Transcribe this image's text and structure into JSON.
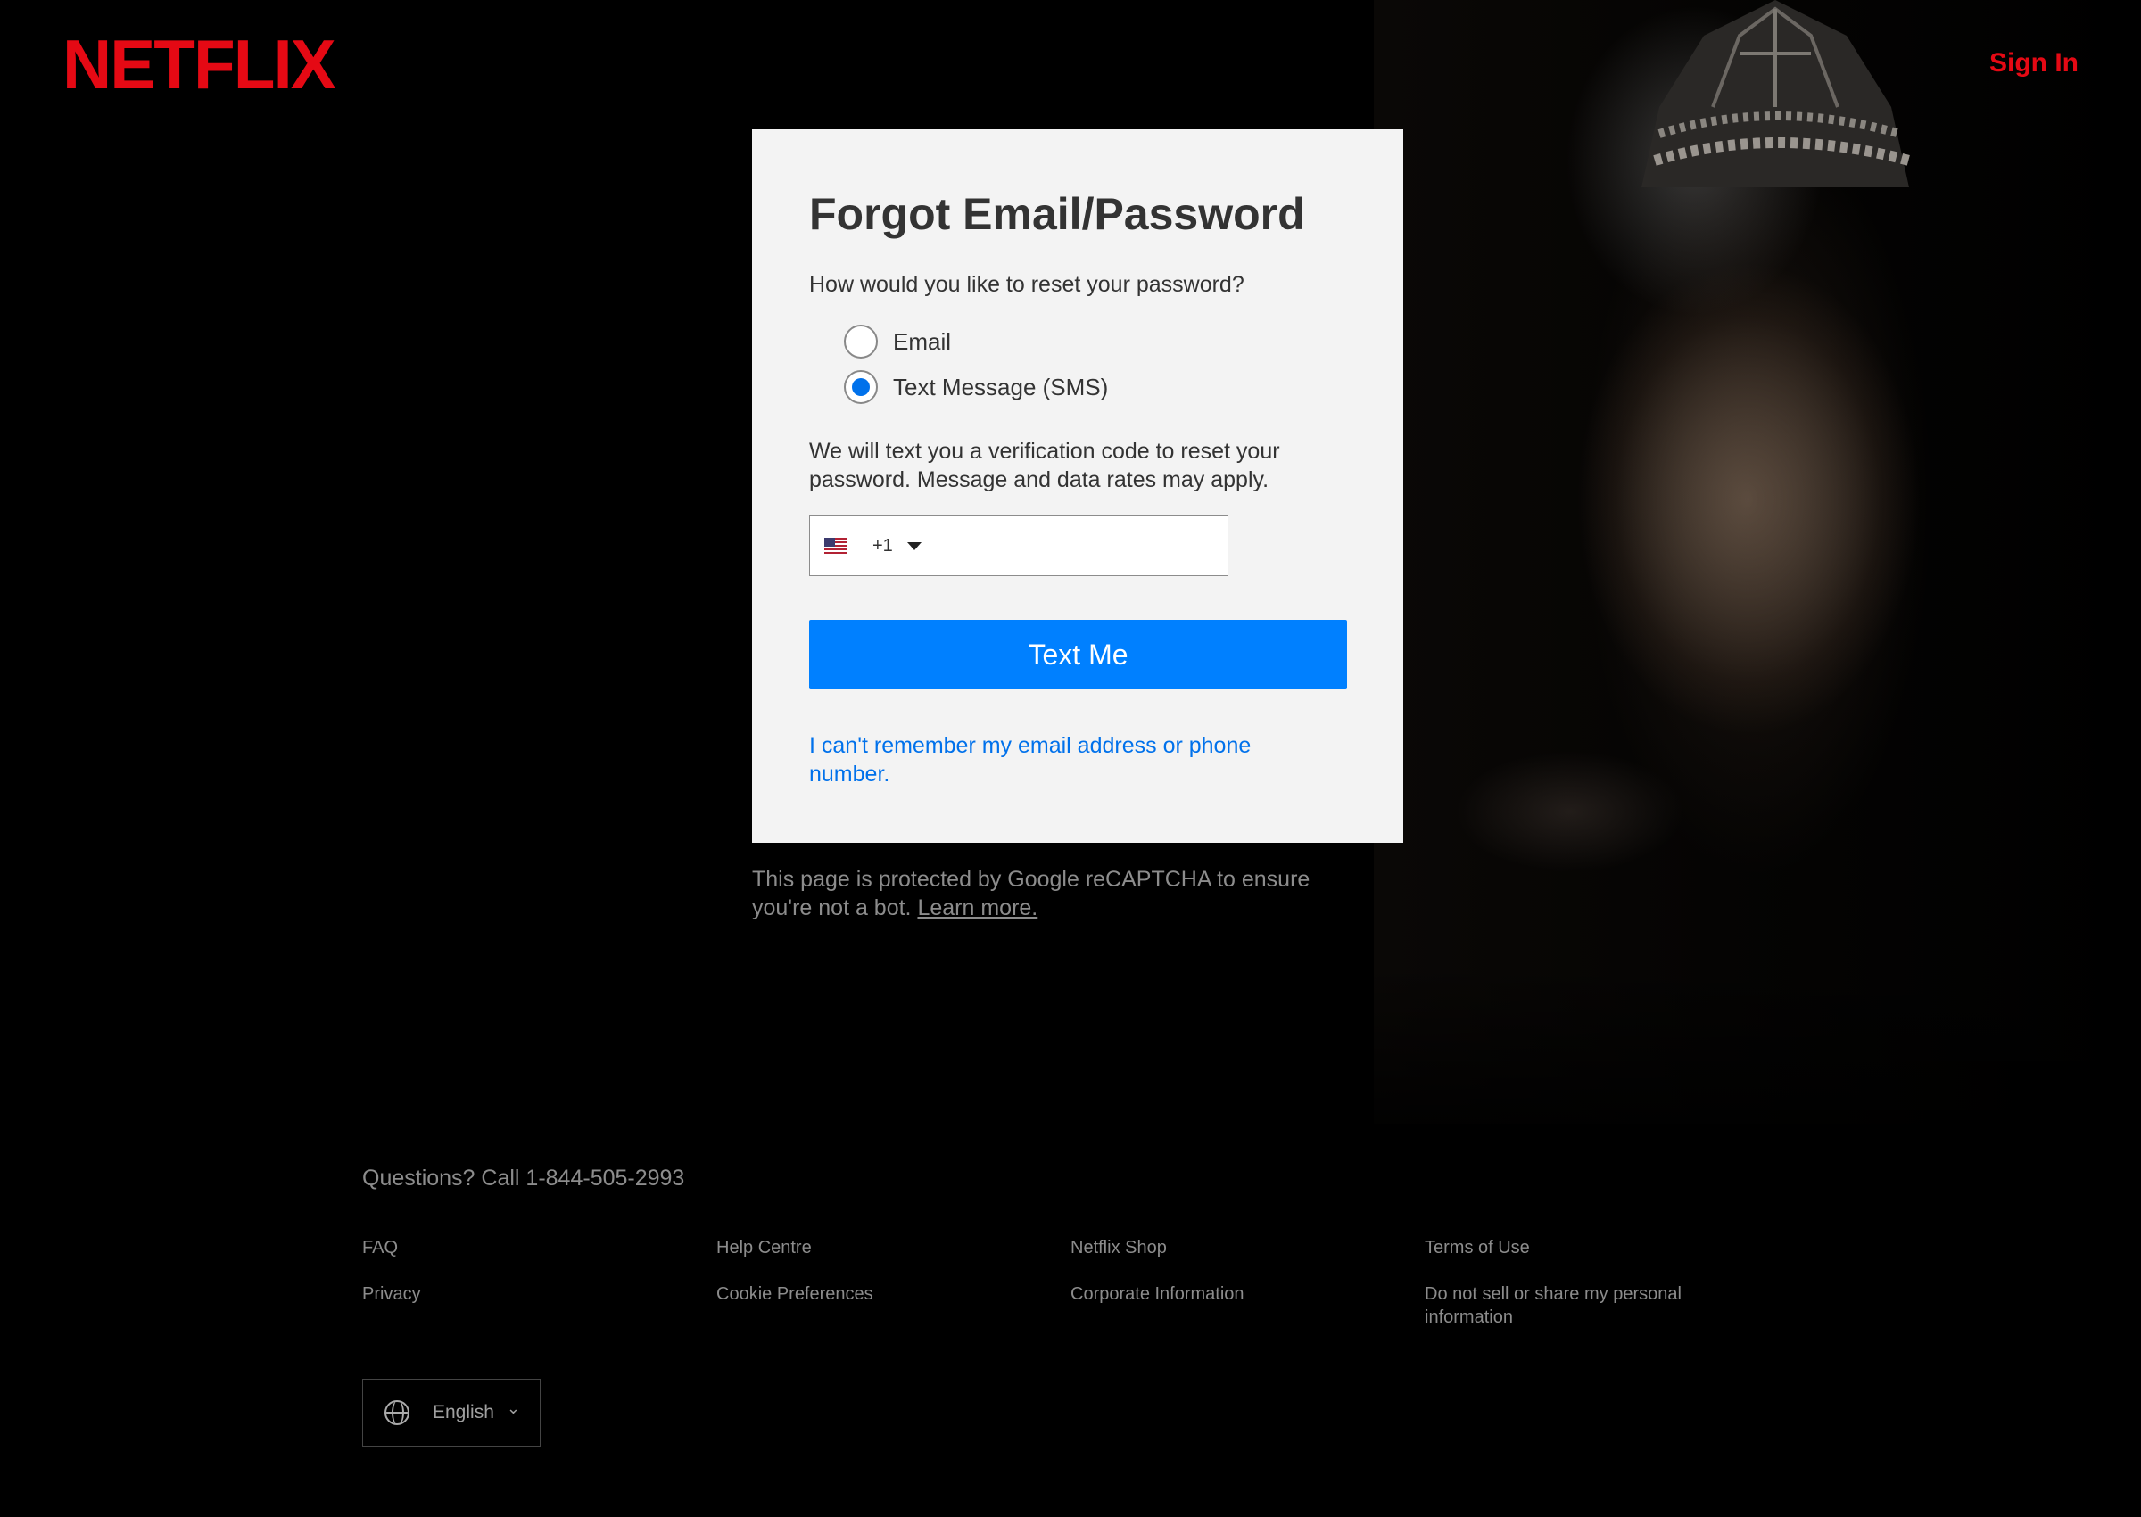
{
  "brand": {
    "name": "NETFLIX",
    "color": "#e50914"
  },
  "header": {
    "sign_in": "Sign In"
  },
  "form": {
    "title": "Forgot Email/Password",
    "prompt": "How would you like to reset your password?",
    "options": [
      {
        "label": "Email",
        "selected": false
      },
      {
        "label": "Text Message (SMS)",
        "selected": true
      }
    ],
    "description": "We will text you a verification code to reset your password. Message and data rates may apply.",
    "phone": {
      "country_code": "+1",
      "country_icon": "us-flag-icon",
      "value": "",
      "placeholder": ""
    },
    "submit_label": "Text Me",
    "submit_color": "#0080ff",
    "cant_remember": "I can't remember my email address or phone number."
  },
  "recaptcha": {
    "text": "This page is protected by Google reCAPTCHA to ensure you're not a bot. ",
    "learn_more": "Learn more."
  },
  "footer": {
    "questions": "Questions? Call 1-844-505-2993",
    "links": [
      "FAQ",
      "Help Centre",
      "Netflix Shop",
      "Terms of Use",
      "Privacy",
      "Cookie Preferences",
      "Corporate Information",
      "Do not sell or share my personal information"
    ],
    "language": "English"
  }
}
